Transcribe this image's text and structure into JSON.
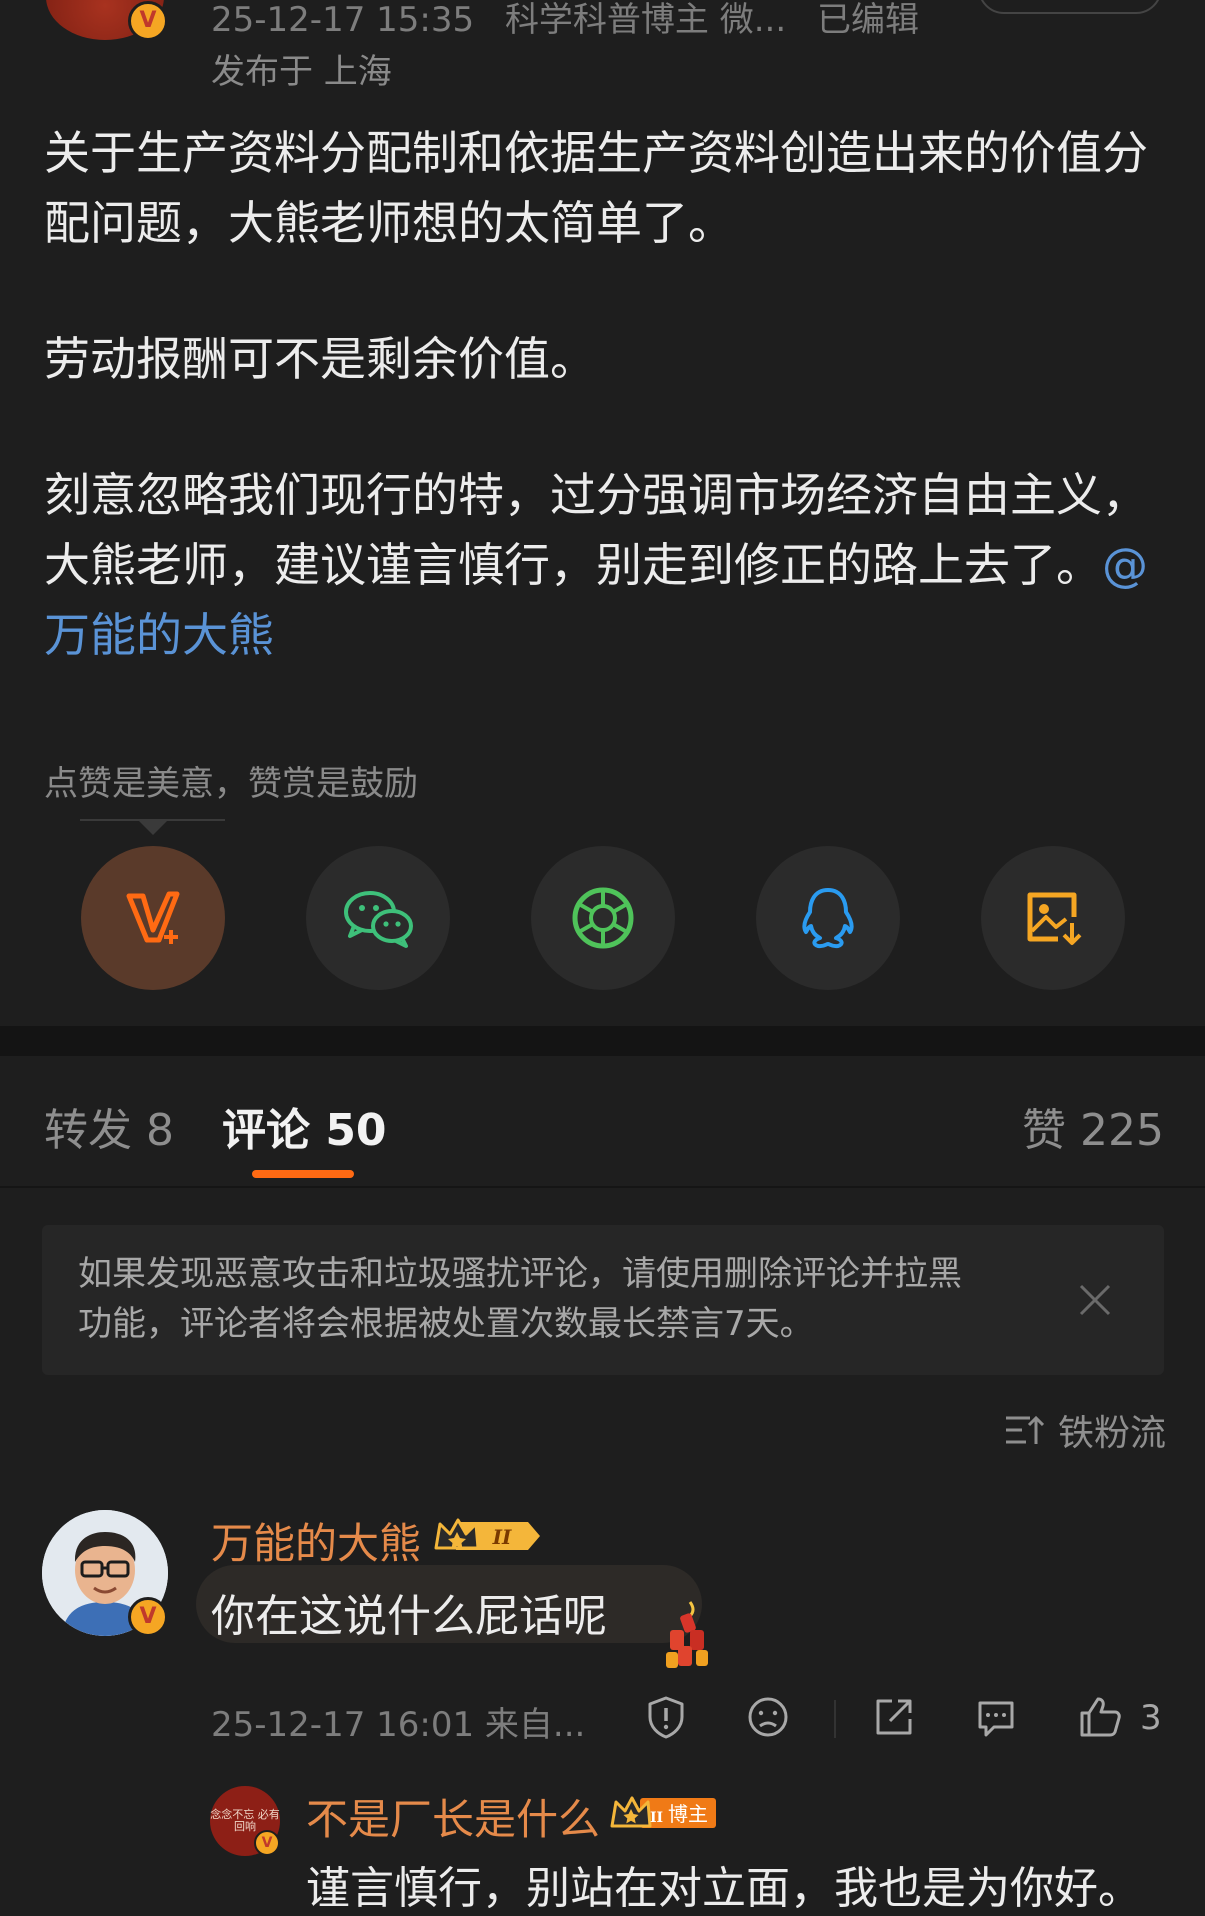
{
  "post": {
    "timestamp": "25-12-17 15:35",
    "author_tag": "科学科普博主 微...",
    "edited": "已编辑",
    "location": "发布于 上海",
    "paragraphs": [
      "关于生产资料分配制和依据生产资料创造出来的价值分配问题，大熊老师想的太简单了。",
      "劳动报酬可不是剩余价值。",
      "刻意忽略我们现行的特，过分强调市场经济自由主义，大熊老师，建议谨言慎行，别走到修正的路上去了。"
    ],
    "mention": "@万能的大熊",
    "reward_hint": "点赞是美意，赞赏是鼓励"
  },
  "share_buttons": [
    {
      "name": "reward-icon",
      "color": "#ff6a13"
    },
    {
      "name": "wechat-icon",
      "color": "#3ec07a"
    },
    {
      "name": "moments-icon",
      "color": "#4fc35a"
    },
    {
      "name": "qq-icon",
      "color": "#2a9bf0"
    },
    {
      "name": "save-image-icon",
      "color": "#f5a623"
    }
  ],
  "tabs": {
    "repost": "转发 8",
    "comments": "评论 50",
    "likes": "赞 225"
  },
  "notice": {
    "text": "如果发现恶意攻击和垃圾骚扰评论，请使用删除评论并拉黑功能，评论者将会根据被处置次数最长禁言7天。"
  },
  "sort": {
    "label": "铁粉流"
  },
  "comment": {
    "author": "万能的大熊",
    "level_badge": "II",
    "text": "你在这说什么屁话呢",
    "meta": "25-12-17 16:01 来自...",
    "like_count": "3"
  },
  "reply": {
    "author": "不是厂长是什么",
    "level_badge": "II",
    "role_badge": "博主",
    "avatar_text": "念念不忘 必有回响",
    "text": "谨言慎行，别站在对立面，我也是为你好。"
  }
}
